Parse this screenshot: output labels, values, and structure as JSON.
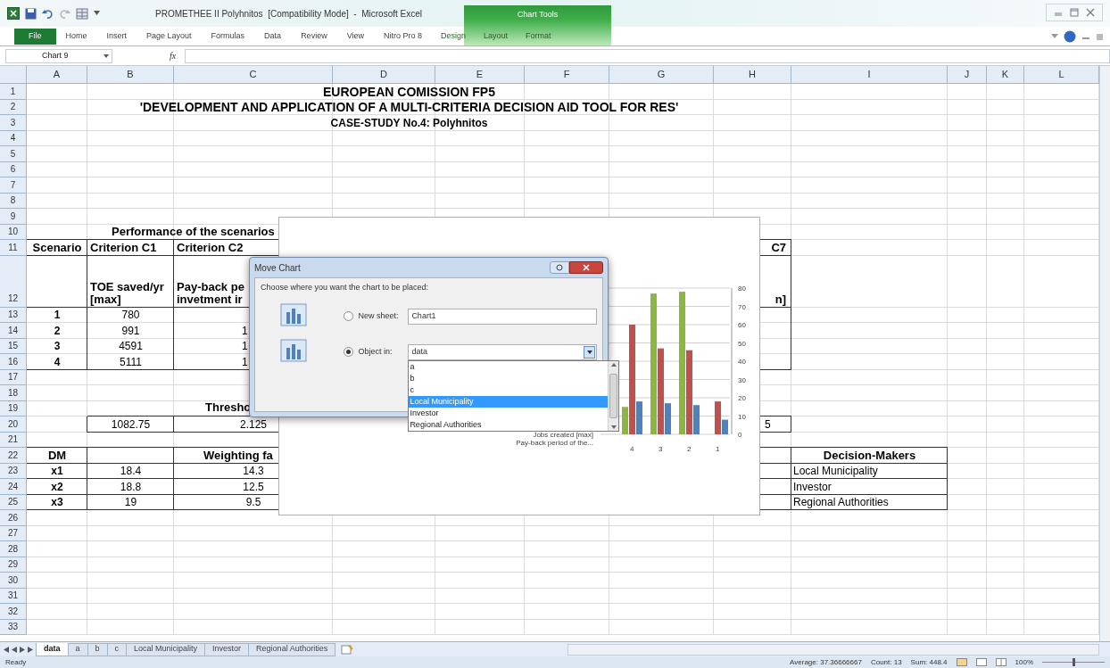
{
  "window": {
    "title": "PROMETHEE II Polyhnitos  [Compatibility Mode]  -  Microsoft Excel",
    "context_group": "Chart Tools"
  },
  "ribbon_tabs": [
    {
      "label": "File",
      "kind": "file"
    },
    {
      "label": "Home",
      "kind": "tab"
    },
    {
      "label": "Insert",
      "kind": "tab"
    },
    {
      "label": "Page Layout",
      "kind": "tab"
    },
    {
      "label": "Formulas",
      "kind": "tab"
    },
    {
      "label": "Data",
      "kind": "tab"
    },
    {
      "label": "Review",
      "kind": "tab"
    },
    {
      "label": "View",
      "kind": "tab"
    },
    {
      "label": "Nitro Pro 8",
      "kind": "tab"
    },
    {
      "label": "Design",
      "kind": "context"
    },
    {
      "label": "Layout",
      "kind": "context"
    },
    {
      "label": "Format",
      "kind": "context"
    }
  ],
  "formula_bar": {
    "name_box": "Chart 9",
    "function_label": "fx"
  },
  "sheet": {
    "columns": [
      "A",
      "B",
      "C",
      "D",
      "E",
      "F",
      "G",
      "H",
      "I",
      "J",
      "K",
      "L"
    ],
    "row_headers": [
      "1",
      "2",
      "3",
      "4",
      "5",
      "6",
      "7",
      "8",
      "9",
      "10",
      "11",
      "12",
      "13",
      "14",
      "15",
      "16",
      "17",
      "18",
      "19",
      "20",
      "21",
      "22",
      "23",
      "24",
      "25",
      "26",
      "27",
      "28",
      "29",
      "30",
      "31",
      "32",
      "33"
    ],
    "title_lines": [
      "EUROPEAN COMISSION FP5",
      "'DEVELOPMENT AND APPLICATION OF A MULTI-CRITERIA DECISION AID TOOL FOR RES'",
      "CASE-STUDY No.4: Polyhnitos"
    ],
    "performance": {
      "caption": "Performance of the scenarios",
      "headers": [
        "Scenario",
        "Criterion C1",
        "Criterion C2",
        "C7"
      ],
      "subheaders": [
        "TOE saved/yr\n[max]",
        "Pay-back pe\ninvetment ir",
        "n]"
      ],
      "rows": [
        [
          "1",
          "780",
          ""
        ],
        [
          "2",
          "991",
          "1"
        ],
        [
          "3",
          "4591",
          "1"
        ],
        [
          "4",
          "5111",
          "1"
        ]
      ]
    },
    "thresholds": {
      "caption": "Thresho",
      "values": [
        "1082.75",
        "2.125",
        "5"
      ]
    },
    "weights": {
      "headers": [
        "DM",
        "Weighting fa",
        "Decision-Makers"
      ],
      "rows": [
        [
          "x1",
          "18.4",
          "14.3",
          "Local Municipality"
        ],
        [
          "x2",
          "18.8",
          "12.5",
          "Investor"
        ],
        [
          "x3",
          "19",
          "9.5",
          "Regional Authorities"
        ]
      ]
    }
  },
  "chart": {
    "depth_labels": [
      "Jobs created [max]",
      "Pay-back period of the..."
    ],
    "chart_data": {
      "type": "bar",
      "categories": [
        "4",
        "3",
        "2",
        "1"
      ],
      "series": [
        {
          "color": "#8db543",
          "values": [
            15,
            77,
            78,
            null
          ]
        },
        {
          "color": "#c0504d",
          "values": [
            60,
            47,
            46,
            18
          ]
        },
        {
          "color": "#4f81bd",
          "values": [
            18,
            17,
            16,
            8
          ]
        }
      ],
      "grid": true,
      "ylim": [
        0,
        80
      ],
      "yticks": [
        0,
        10,
        20,
        30,
        40,
        50,
        60,
        70,
        80
      ]
    }
  },
  "dialog": {
    "title": "Move Chart",
    "prompt": "Choose where you want the chart to be placed:",
    "options": [
      {
        "label": "New sheet:",
        "selected": false,
        "value": "Chart1"
      },
      {
        "label": "Object in:",
        "selected": true,
        "value": "data"
      }
    ],
    "list": [
      {
        "label": "a",
        "selected": false
      },
      {
        "label": "b",
        "selected": false
      },
      {
        "label": "c",
        "selected": false
      },
      {
        "label": "Local Municipality",
        "selected": true
      },
      {
        "label": "Investor",
        "selected": false
      },
      {
        "label": "Regional Authorities",
        "selected": false
      }
    ]
  },
  "sheet_tabs": [
    {
      "label": "data",
      "selected": true
    },
    {
      "label": "a",
      "selected": false
    },
    {
      "label": "b",
      "selected": false
    },
    {
      "label": "c",
      "selected": false
    },
    {
      "label": "Local Municipality",
      "selected": false
    },
    {
      "label": "Investor",
      "selected": false
    },
    {
      "label": "Regional Authorities",
      "selected": false
    }
  ],
  "status_bar": {
    "mode": "Ready",
    "average": "Average: 37.36666667",
    "count": "Count: 13",
    "sum": "Sum: 448.4",
    "zoom": "100%",
    "zoom_slider": {
      "level": 0.5
    }
  }
}
